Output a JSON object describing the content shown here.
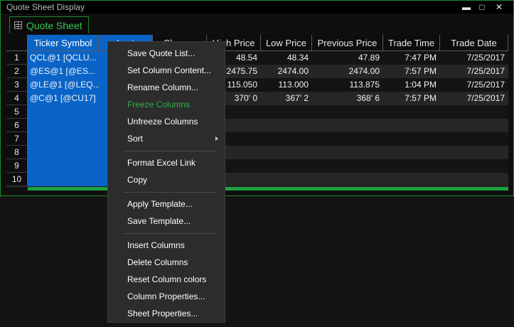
{
  "window": {
    "title": "Quote Sheet Display",
    "tab_label": "Quote Sheet"
  },
  "window_controls": {
    "minimize": "▬",
    "maximize": "□",
    "close": "✕"
  },
  "grid": {
    "columns": [
      "Ticker Symbol",
      "Last",
      "Change",
      "High Price",
      "Low Price",
      "Previous Price",
      "Trade Time",
      "Trade Date"
    ],
    "rows": [
      {
        "num": "1",
        "symbol": "QCL@1 [QCLU...",
        "last": "",
        "change": "",
        "high": "48.54",
        "low": "48.34",
        "prev": "47.89",
        "time": "7:47 PM",
        "date": "7/25/2017"
      },
      {
        "num": "2",
        "symbol": "@ES@1 [@ES...",
        "last": "",
        "change": "",
        "high": "2475.75",
        "low": "2474.00",
        "prev": "2474.00",
        "time": "7:57 PM",
        "date": "7/25/2017"
      },
      {
        "num": "3",
        "symbol": "@LE@1 [@LEQ...",
        "last": "",
        "change": "",
        "high": "115.050",
        "low": "113.000",
        "prev": "113.875",
        "time": "1:04 PM",
        "date": "7/25/2017"
      },
      {
        "num": "4",
        "symbol": "@C@1 [@CU17]",
        "last": "",
        "change": "",
        "high": "370' 0",
        "low": "367' 2",
        "prev": "368' 6",
        "time": "7:57 PM",
        "date": "7/25/2017"
      },
      {
        "num": "5",
        "symbol": "",
        "last": "",
        "change": "",
        "high": "",
        "low": "",
        "prev": "",
        "time": "",
        "date": ""
      },
      {
        "num": "6",
        "symbol": "",
        "last": "",
        "change": "",
        "high": "",
        "low": "",
        "prev": "",
        "time": "",
        "date": ""
      },
      {
        "num": "7",
        "symbol": "",
        "last": "",
        "change": "",
        "high": "",
        "low": "",
        "prev": "",
        "time": "",
        "date": ""
      },
      {
        "num": "8",
        "symbol": "",
        "last": "",
        "change": "",
        "high": "",
        "low": "",
        "prev": "",
        "time": "",
        "date": ""
      },
      {
        "num": "9",
        "symbol": "",
        "last": "",
        "change": "",
        "high": "",
        "low": "",
        "prev": "",
        "time": "",
        "date": ""
      },
      {
        "num": "10",
        "symbol": "",
        "last": "",
        "change": "",
        "high": "",
        "low": "",
        "prev": "",
        "time": "",
        "date": ""
      }
    ]
  },
  "context_menu": {
    "groups": [
      [
        {
          "label": "Save Quote List...",
          "enabled": true
        },
        {
          "label": "Set Column Content...",
          "enabled": true
        },
        {
          "label": "Rename Column...",
          "enabled": true
        },
        {
          "label": "Freeze Columns",
          "enabled": false
        },
        {
          "label": "Unfreeze Columns",
          "enabled": true
        },
        {
          "label": "Sort",
          "enabled": true,
          "submenu": true
        }
      ],
      [
        {
          "label": "Format Excel Link",
          "enabled": true
        },
        {
          "label": "Copy",
          "enabled": true
        }
      ],
      [
        {
          "label": "Apply Template...",
          "enabled": true
        },
        {
          "label": "Save Template...",
          "enabled": true
        }
      ],
      [
        {
          "label": "Insert Columns",
          "enabled": true
        },
        {
          "label": "Delete Columns",
          "enabled": true
        },
        {
          "label": "Reset Column colors",
          "enabled": true
        },
        {
          "label": "Column Properties...",
          "enabled": true
        },
        {
          "label": "Sheet Properties...",
          "enabled": true
        }
      ]
    ]
  },
  "colors": {
    "accent_green": "#1fa040",
    "selection_blue": "#0a64c8",
    "disabled_text": "#2fb04a"
  }
}
